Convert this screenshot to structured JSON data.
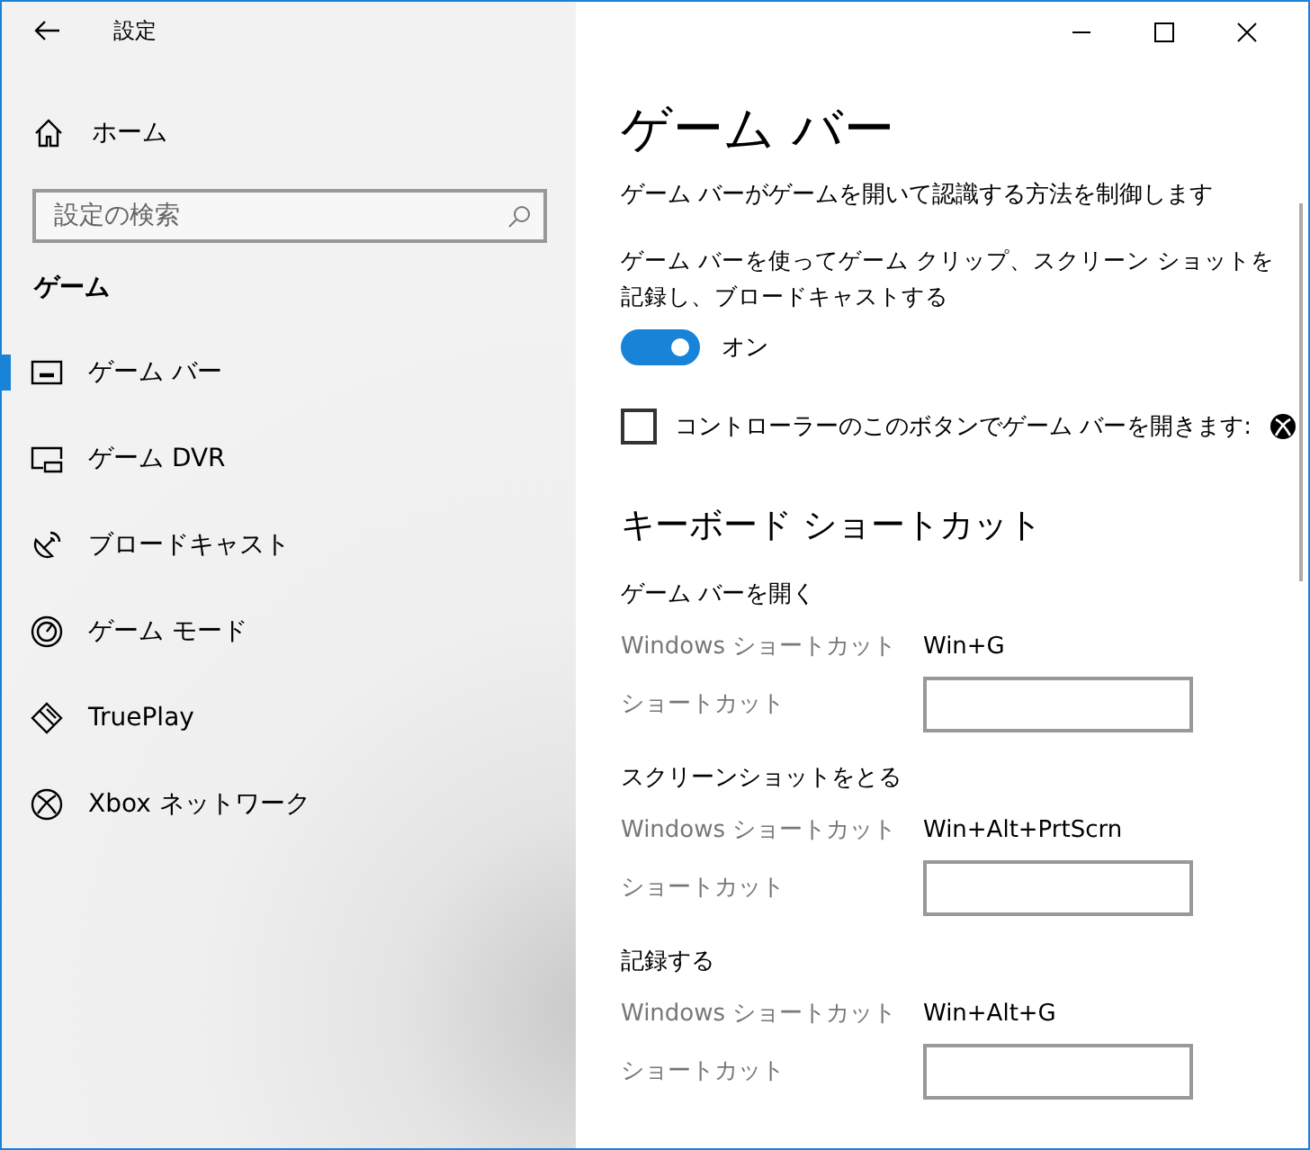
{
  "window": {
    "title": "設定"
  },
  "sidebar": {
    "home": "ホーム",
    "search": {
      "placeholder": "設定の検索"
    },
    "section": "ゲーム",
    "items": [
      {
        "label": "ゲーム バー",
        "kind": "gamebar",
        "selected": true
      },
      {
        "label": "ゲーム DVR",
        "kind": "dvr",
        "selected": false
      },
      {
        "label": "ブロードキャスト",
        "kind": "broadcast",
        "selected": false
      },
      {
        "label": "ゲーム モード",
        "kind": "gamemode",
        "selected": false
      },
      {
        "label": "TruePlay",
        "kind": "trueplay",
        "selected": false
      },
      {
        "label": "Xbox ネットワーク",
        "kind": "xbox",
        "selected": false
      }
    ]
  },
  "page": {
    "title": "ゲーム バー",
    "description": "ゲーム バーがゲームを開いて認識する方法を制御します",
    "toggle": {
      "label": "ゲーム バーを使ってゲーム クリップ、スクリーン ショットを記録し、ブロードキャストする",
      "on": true,
      "state_text": "オン"
    },
    "checkbox": {
      "label": "コントローラーのこのボタンでゲーム バーを開きます:",
      "checked": false
    },
    "shortcuts_heading": "キーボード ショートカット",
    "shortcuts": [
      {
        "title": "ゲーム バーを開く",
        "windows_label": "Windows ショートカット",
        "windows_value": "Win+G",
        "custom_label": "ショートカット"
      },
      {
        "title": "スクリーンショットをとる",
        "windows_label": "Windows ショートカット",
        "windows_value": "Win+Alt+PrtScrn",
        "custom_label": "ショートカット"
      },
      {
        "title": "記録する",
        "windows_label": "Windows ショートカット",
        "windows_value": "Win+Alt+G",
        "custom_label": "ショートカット"
      }
    ]
  }
}
